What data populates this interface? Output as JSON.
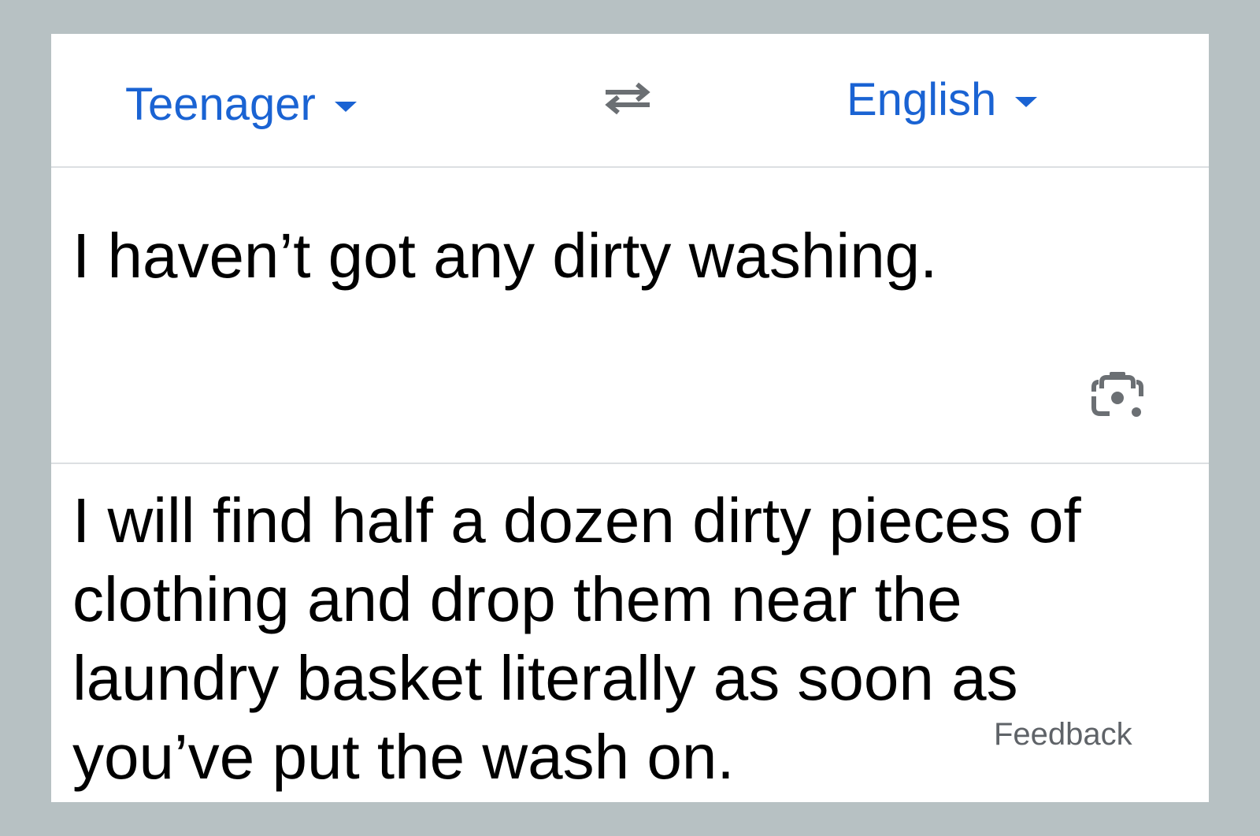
{
  "language_bar": {
    "source_language": "Teenager",
    "target_language": "English",
    "swap_icon": "swap-arrows-icon"
  },
  "source": {
    "text": "I haven’t got any dirty washing.",
    "camera_icon": "camera-lens-icon"
  },
  "result": {
    "text": "I will find half a dozen dirty pieces of clothing and drop them near the laundry basket literally as soon as you’ve put the wash on.",
    "feedback_label": "Feedback"
  },
  "colors": {
    "background": "#b7c1c3",
    "card": "#ffffff",
    "accent": "#1a63d3",
    "icon_gray": "#6b6f73",
    "divider": "#dcdfe2"
  }
}
